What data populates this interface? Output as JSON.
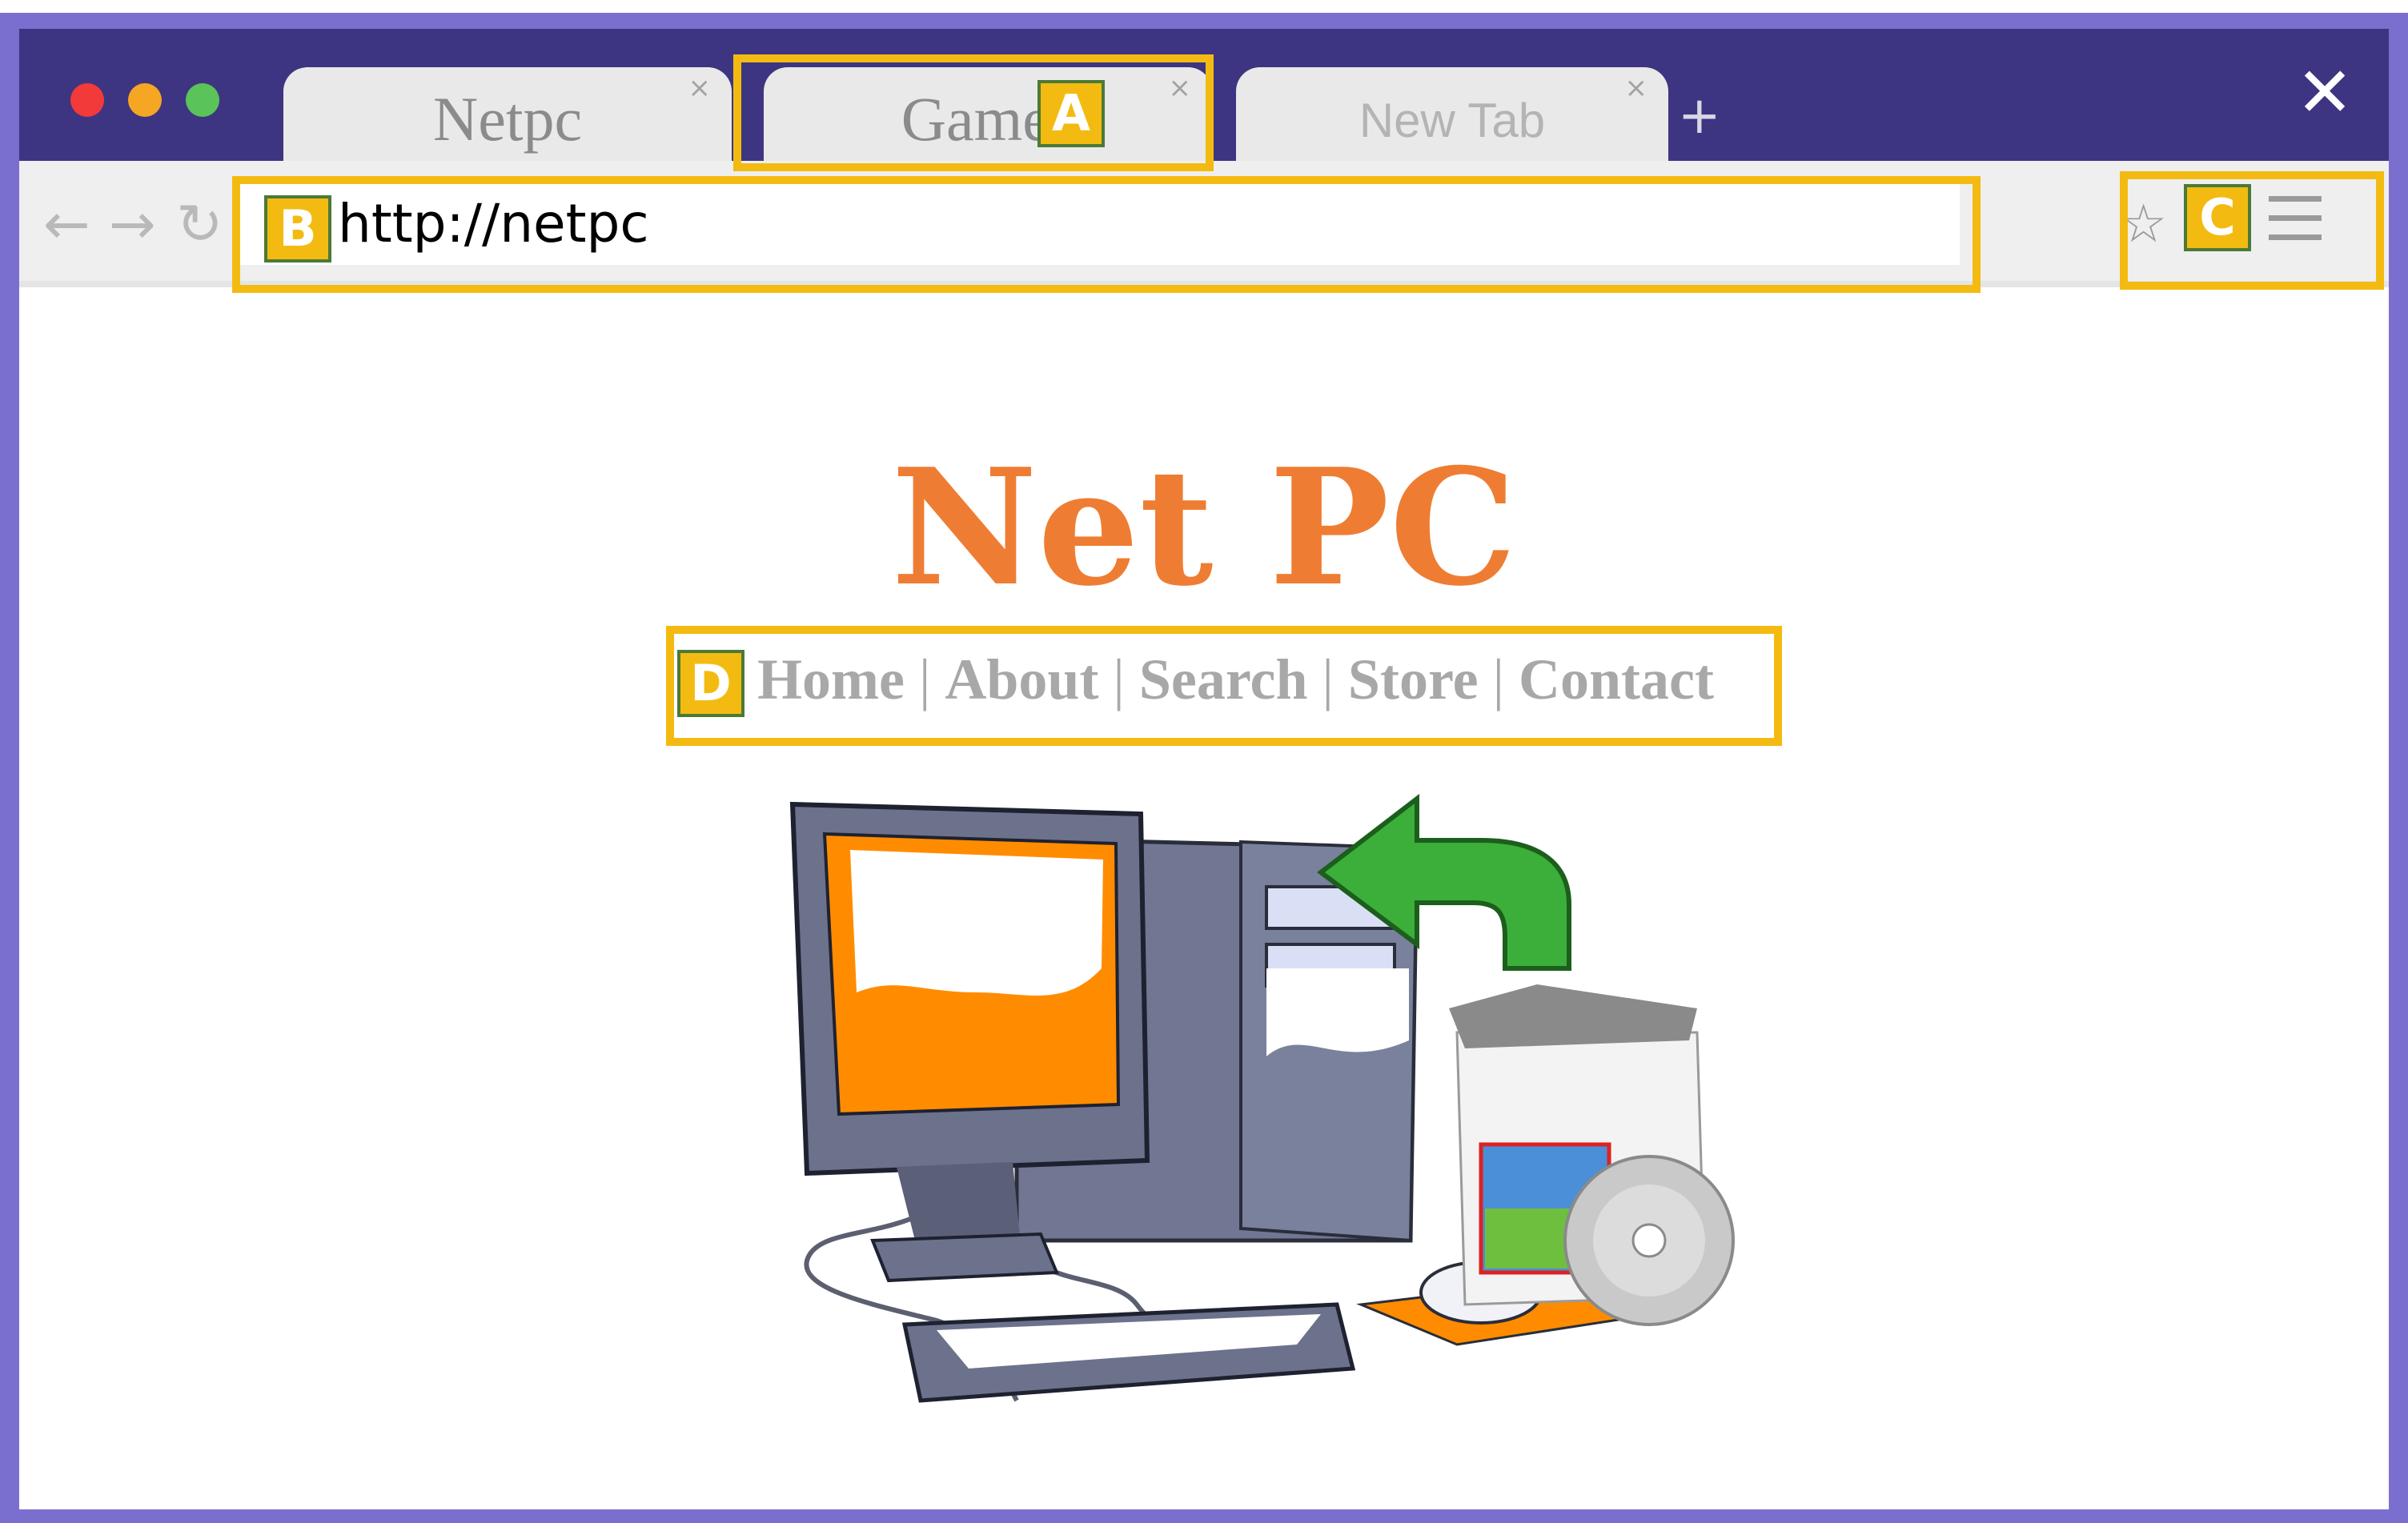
{
  "browser": {
    "tabs": [
      {
        "label": "Netpc",
        "close": "×"
      },
      {
        "label": "Games",
        "close": "×"
      },
      {
        "label": "New Tab",
        "close": "×"
      }
    ],
    "new_tab": "+",
    "close_window": "✕",
    "url": "http://netpc"
  },
  "annotations": {
    "a": "A",
    "b": "B",
    "c": "C",
    "d": "D"
  },
  "site": {
    "title": "Net PC",
    "nav": [
      "Home",
      "About",
      "Search",
      "Store",
      "Contact"
    ],
    "separator": "|"
  },
  "colors": {
    "frame": "#7a6fcf",
    "titlebar": "#3d3581",
    "highlight": "#f3bb12",
    "title": "#ee7d33",
    "nav": "#a8a8a8"
  },
  "icons": [
    "back-arrow-icon",
    "forward-arrow-icon",
    "reload-icon",
    "bookmark-star-icon",
    "menu-icon",
    "close-icon"
  ]
}
